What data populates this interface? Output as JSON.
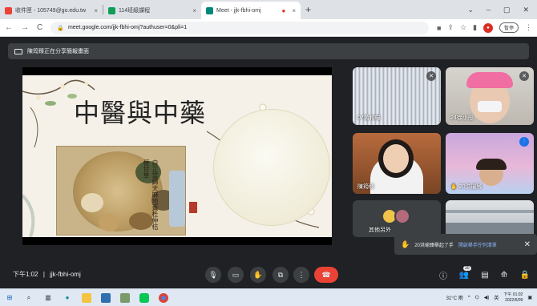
{
  "browser": {
    "tabs": [
      {
        "label": "收件匣 - 105749@go.edu.tw",
        "color": "#ea4335"
      },
      {
        "label": "114班級課程",
        "color": "#0f9d58"
      },
      {
        "label": "Meet - jjk-fbhi-omj",
        "color": "#00897b"
      }
    ],
    "url": "meet.google.com/jjk-fbhi-omj?authuser=0&pli=1",
    "profile_pill": "暫停"
  },
  "meet": {
    "banner_text": "陳筠臻正在分享簡報畫面",
    "slide": {
      "title": "中醫與中藥",
      "poem": "白芷當歸天麻地黃杜仲桔梗甘草"
    },
    "participants": [
      {
        "name": "07黃和喵"
      },
      {
        "name": "24徐小彤"
      },
      {
        "name": "陳筠臻"
      },
      {
        "name": "20洪瑜臻"
      },
      {
        "name": "其他另外"
      },
      {
        "name": ""
      }
    ],
    "toast": {
      "message": "20洪瑜臻舉起了手",
      "link": "開啟舉手佇列清單"
    },
    "time": "下午1:02",
    "meeting_code": "jjk-fbhi-omj",
    "participant_badge": "30"
  },
  "taskbar": {
    "weather": "31°C 雨",
    "lang": "英",
    "clock_time": "下午 01:02",
    "clock_date": "2022/6/09"
  }
}
